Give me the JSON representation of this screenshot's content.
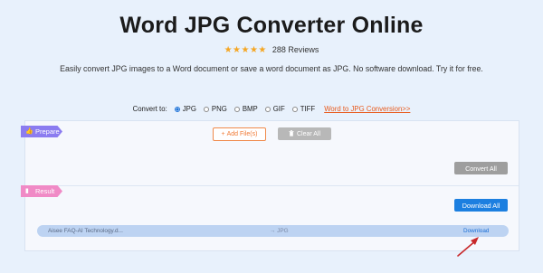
{
  "header": {
    "title": "Word JPG Converter Online",
    "stars": "★★★★★",
    "reviews": "288 Reviews",
    "subtitle": "Easily convert JPG images to a Word document or save a word document as JPG. No software download. Try it for free."
  },
  "convert": {
    "label": "Convert to:",
    "options": [
      "JPG",
      "PNG",
      "BMP",
      "GIF",
      "TIFF"
    ],
    "selected": "JPG",
    "link": "Word to JPG Conversion>>"
  },
  "prepare": {
    "tag": "Prepare",
    "add_files": "Add File(s)",
    "clear_all": "Clear All",
    "convert_all": "Convert All"
  },
  "result": {
    "tag": "Result",
    "download_all": "Download All",
    "file": {
      "name": "Aisee FAQ-AI Technology.d...",
      "target": "→ JPG",
      "download": "Download"
    }
  },
  "colors": {
    "background": "#e8f1fc",
    "prepare_tag": "#8b7cf0",
    "result_tag": "#f08ac6",
    "accent_orange": "#f07a35",
    "primary_blue": "#1c7fe0",
    "arrow_red": "#c8292b"
  }
}
